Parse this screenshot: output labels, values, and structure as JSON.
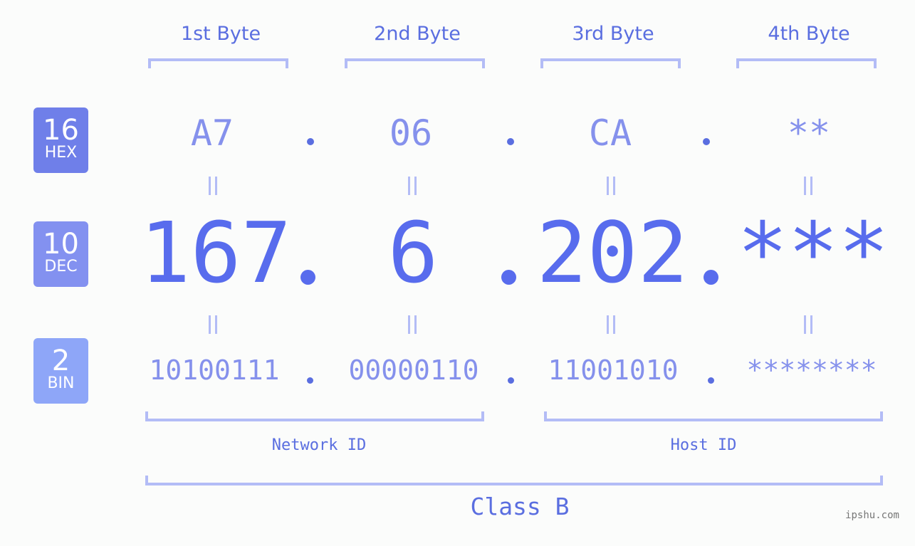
{
  "byte_headers": [
    "1st Byte",
    "2nd Byte",
    "3rd Byte",
    "4th Byte"
  ],
  "bases": [
    {
      "num": "16",
      "label": "HEX",
      "color": "#6f7fe9"
    },
    {
      "num": "10",
      "label": "DEC",
      "color": "#8391f0"
    },
    {
      "num": "2",
      "label": "BIN",
      "color": "#8ea6f8"
    }
  ],
  "hex": [
    "A7",
    "06",
    "CA",
    "**"
  ],
  "dec": [
    "167",
    "6",
    "202",
    "***"
  ],
  "bin": [
    "10100111",
    "00000110",
    "11001010",
    "********"
  ],
  "separator": ".",
  "network_id_label": "Network ID",
  "host_id_label": "Host ID",
  "class_label": "Class B",
  "watermark": "ipshu.com",
  "colors": {
    "accent": "#586ced",
    "light": "#8591ec",
    "bracket": "#b3bcf6"
  }
}
